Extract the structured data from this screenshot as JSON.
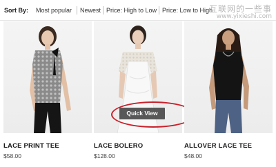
{
  "sort": {
    "label": "Sort By:",
    "options": [
      "Most popular",
      "Newest",
      "Price: High to Low",
      "Price: Low to High"
    ]
  },
  "watermark": {
    "line1": "互联网的一些事",
    "line2": "www.yixieshi.com"
  },
  "products": [
    {
      "name": "LACE PRINT TEE",
      "price": "$58.00"
    },
    {
      "name": "LACE BOLERO",
      "price": "$128.00",
      "quick_view_label": "Quick View"
    },
    {
      "name": "ALLOVER LACE TEE",
      "price": "$48.00"
    }
  ],
  "colors": {
    "highlight_ring": "#c8202a",
    "quick_view_bg": "#3c3c3c"
  }
}
